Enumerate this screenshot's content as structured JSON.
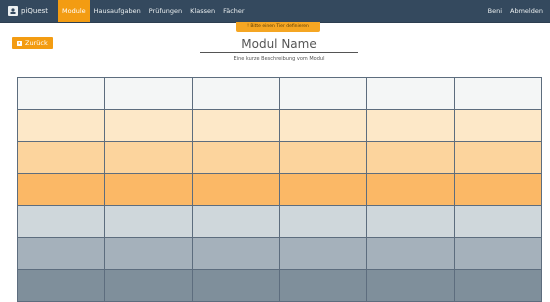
{
  "navbar": {
    "brand": "piQuest",
    "items": [
      {
        "label": "Module",
        "active": true
      },
      {
        "label": "Hausaufgaben",
        "active": false
      },
      {
        "label": "Prüfungen",
        "active": false
      },
      {
        "label": "Klassen",
        "active": false
      },
      {
        "label": "Fächer",
        "active": false
      }
    ],
    "user": "Beni",
    "logout": "Abmelden"
  },
  "alert": "! Bitte einen Tier definieren",
  "back_button": "Zurück",
  "module": {
    "title": "Modul Name",
    "description": "Eine kurze Beschreibung vom Modul"
  },
  "grid": {
    "rows": 7,
    "columns": 6,
    "row_colors": [
      "#f4f6f6",
      "#fde8c8",
      "#fcd49d",
      "#fbb866",
      "#cfd7db",
      "#a5b1bb",
      "#7f8f9b"
    ]
  },
  "colors": {
    "navbar": "#34495e",
    "accent": "#f39c12"
  }
}
